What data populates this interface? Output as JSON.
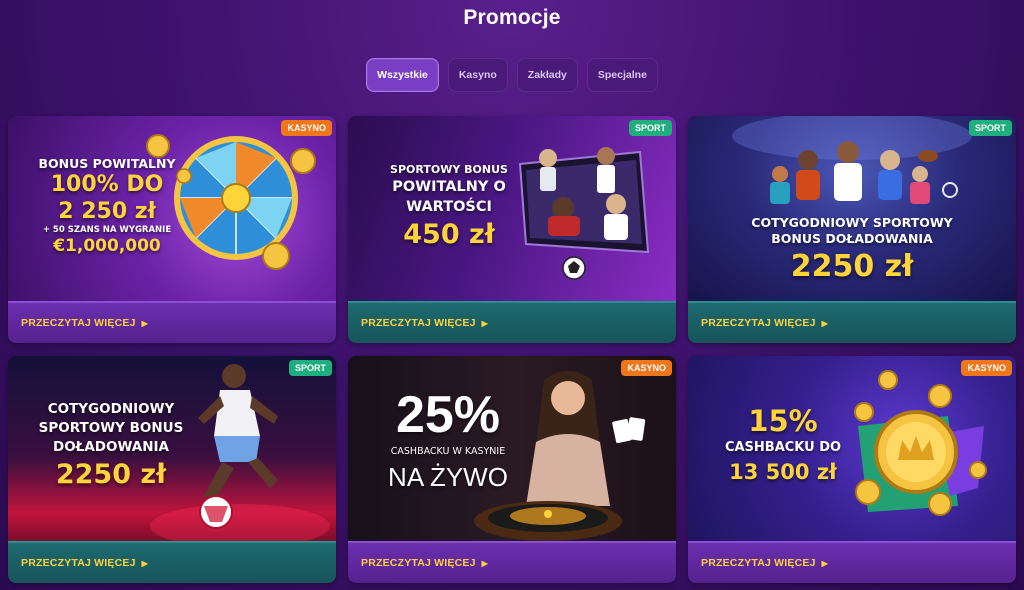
{
  "page": {
    "title": "Promocje"
  },
  "tabs": [
    {
      "label": "Wszystkie",
      "active": true
    },
    {
      "label": "Kasyno",
      "active": false
    },
    {
      "label": "Zakłady",
      "active": false
    },
    {
      "label": "Specjalne",
      "active": false
    }
  ],
  "cards": [
    {
      "badge": "KASYNO",
      "lines": [
        "BONUS POWITALNY",
        "100% DO",
        "2 250 zł",
        "+ 50 SZANS NA WYGRANIE",
        "€1,000,000"
      ],
      "read_more": "PRZECZYTAJ WIĘCEJ"
    },
    {
      "badge": "SPORT",
      "lines": [
        "SPORTOWY BONUS",
        "POWITALNY O",
        "WARTOŚCI",
        "450 zł"
      ],
      "read_more": "PRZECZYTAJ WIĘCEJ"
    },
    {
      "badge": "SPORT",
      "lines": [
        "COTYGODNIOWY SPORTOWY",
        "BONUS DOŁADOWANIA",
        "2250 zł"
      ],
      "read_more": "PRZECZYTAJ WIĘCEJ"
    },
    {
      "badge": "SPORT",
      "lines": [
        "COTYGODNIOWY",
        "SPORTOWY BONUS",
        "DOŁADOWANIA",
        "2250 zł"
      ],
      "read_more": "PRZECZYTAJ WIĘCEJ"
    },
    {
      "badge": "KASYNO",
      "lines": [
        "25%",
        "CASHBACKU W KASYNIE",
        "NA ŻYWO"
      ],
      "read_more": "PRZECZYTAJ WIĘCEJ"
    },
    {
      "badge": "KASYNO",
      "lines": [
        "15%",
        "CASHBACKU DO",
        "13 500 zł"
      ],
      "read_more": "PRZECZYTAJ WIĘCEJ"
    }
  ],
  "colors": {
    "accent_gold": "#ffd23a",
    "badge_casino": "#f0761c",
    "badge_sport": "#1fae7e",
    "tab_active": "#7a3ec4"
  }
}
